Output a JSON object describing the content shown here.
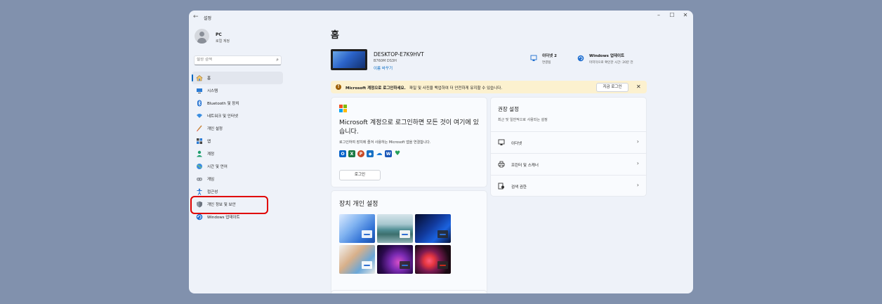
{
  "window": {
    "title": "설정",
    "back_icon": "←",
    "controls": {
      "minimize": "–",
      "maximize": "☐",
      "close": "✕"
    }
  },
  "profile": {
    "name": "PC",
    "subtitle": "로컬 계정"
  },
  "search": {
    "placeholder": "설정 검색"
  },
  "sidebar": {
    "items": [
      {
        "label": "홈",
        "icon": "home-icon",
        "active": true
      },
      {
        "label": "시스템",
        "icon": "system-icon"
      },
      {
        "label": "Bluetooth 및 장치",
        "icon": "bluetooth-icon"
      },
      {
        "label": "네트워크 및 인터넷",
        "icon": "network-icon"
      },
      {
        "label": "개인 설정",
        "icon": "brush-icon"
      },
      {
        "label": "앱",
        "icon": "apps-icon"
      },
      {
        "label": "계정",
        "icon": "account-icon"
      },
      {
        "label": "시간 및 언어",
        "icon": "globe-icon"
      },
      {
        "label": "게임",
        "icon": "gamepad-icon"
      },
      {
        "label": "접근성",
        "icon": "accessibility-icon"
      },
      {
        "label": "개인 정보 및 보안",
        "icon": "shield-icon"
      },
      {
        "label": "Windows 업데이트",
        "icon": "update-icon"
      }
    ]
  },
  "main": {
    "title": "홈",
    "device": {
      "name": "DESKTOP-E7K9HVT",
      "model": "B760M DS3H",
      "rename": "이름 바꾸기"
    },
    "status": [
      {
        "title": "이더넷 2",
        "subtitle": "연결됨",
        "icon": "ethernet-icon"
      },
      {
        "title": "Windows 업데이트",
        "subtitle": "마지막으로 확인한 시간: 20분 전",
        "icon": "update-icon"
      }
    ],
    "banner": {
      "bold": "Microsoft 계정으로 로그인하세요.",
      "text": "파일 및 사진을 백업하여 더 안전하게 유지할 수 있습니다.",
      "button": "지금 로그인",
      "close": "✕"
    },
    "ms_card": {
      "heading": "Microsoft 계정으로 로그인하면 모든 것이 여기에 있습니다.",
      "description": "로그인하여 장치에 즐겨 사용하는 Microsoft 앱을 연결합니다.",
      "button": "로그인",
      "apps": [
        "outlook-icon",
        "excel-icon",
        "powerpoint-icon",
        "defender-icon",
        "onedrive-icon",
        "word-icon",
        "family-icon"
      ]
    },
    "personalize": {
      "title": "장치 개인 설정"
    },
    "recommended": {
      "title": "권장 설정",
      "subtitle": "최근 및 일반적으로 사용되는 설정",
      "items": [
        {
          "label": "이더넷",
          "icon": "ethernet-icon"
        },
        {
          "label": "프린터 및 스캐너",
          "icon": "printer-icon"
        },
        {
          "label": "검색 권한",
          "icon": "search-permissions-icon"
        }
      ]
    }
  },
  "colors": {
    "accent": "#0067c0",
    "highlight": "#e00000",
    "banner": "#fcf1cf",
    "background": "#8191ad"
  }
}
